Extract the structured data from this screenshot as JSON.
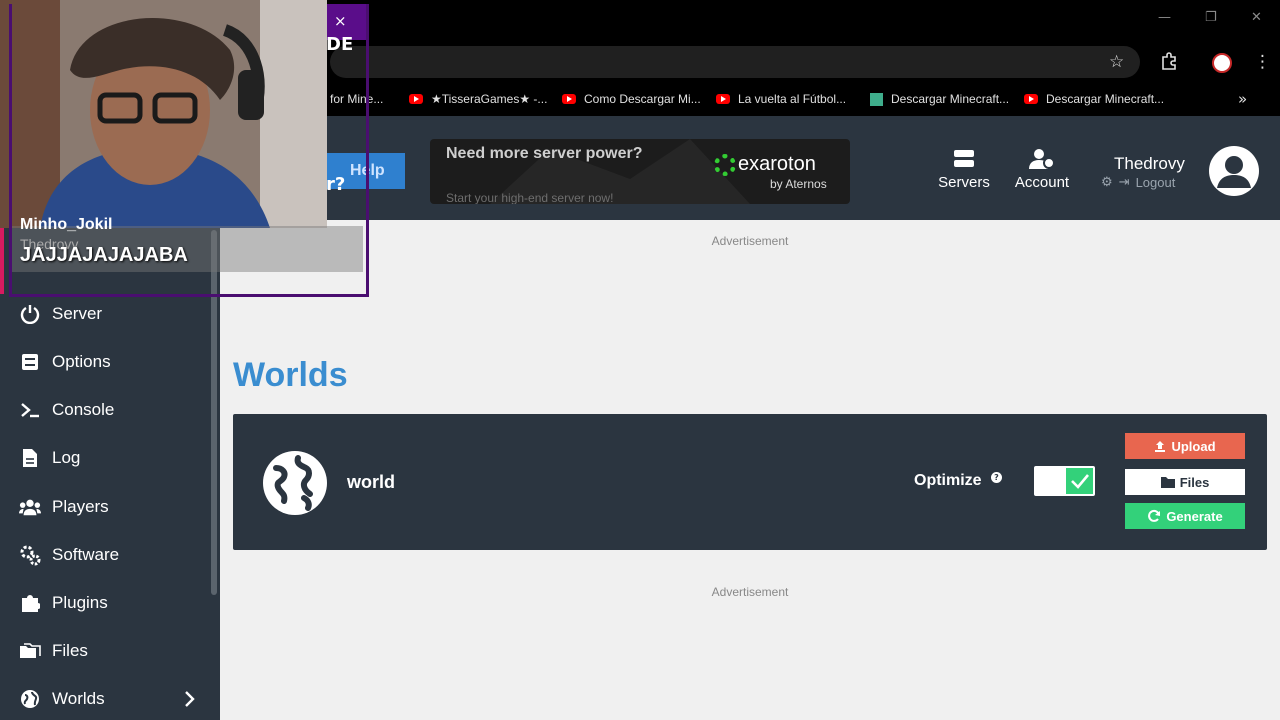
{
  "browser": {
    "tab_close": "×",
    "tab_text_fragment": "DE",
    "bookmarks": [
      {
        "label": "d for Mine...",
        "icon": "none"
      },
      {
        "label": "★TisseraGames★ -...",
        "icon": "youtube"
      },
      {
        "label": "Como Descargar Mi...",
        "icon": "youtube"
      },
      {
        "label": "La vuelta al Fútbol...",
        "icon": "youtube"
      },
      {
        "label": "Descargar Minecraft...",
        "icon": "minecraft"
      },
      {
        "label": "Descargar Minecraft...",
        "icon": "youtube"
      }
    ],
    "bookmarks_more": "»"
  },
  "header": {
    "help_label": "Help",
    "partial_text": "r?",
    "ad": {
      "headline": "Need more server power?",
      "subline": "Start your high-end server now!",
      "brand": "exaroton",
      "brand_by": "by Aternos"
    },
    "nav": [
      {
        "label": "Servers",
        "icon": "servers-icon"
      },
      {
        "label": "Account",
        "icon": "account-icon"
      }
    ],
    "username": "Thedrovy",
    "logout": "Logout"
  },
  "sidebar": {
    "items": [
      {
        "label": "Server",
        "icon": "power-icon"
      },
      {
        "label": "Options",
        "icon": "sliders-icon"
      },
      {
        "label": "Console",
        "icon": "terminal-icon"
      },
      {
        "label": "Log",
        "icon": "file-icon"
      },
      {
        "label": "Players",
        "icon": "users-icon"
      },
      {
        "label": "Software",
        "icon": "cogs-icon"
      },
      {
        "label": "Plugins",
        "icon": "puzzle-icon"
      },
      {
        "label": "Files",
        "icon": "folders-icon"
      },
      {
        "label": "Worlds",
        "icon": "globe-icon"
      }
    ]
  },
  "main": {
    "ad_label_top": "Advertisement",
    "title": "Worlds",
    "world": {
      "name": "world",
      "optimize_label": "Optimize",
      "optimize_enabled": true,
      "buttons": {
        "upload": "Upload",
        "files": "Files",
        "generate": "Generate"
      }
    },
    "ad_label_bottom": "Advertisement"
  },
  "overlay": {
    "chat_top": "Minho_Jokil",
    "chat_ghost": "Thedrovy",
    "chat_message": "JAJJAJAJAJABA"
  },
  "colors": {
    "panel_bg": "#2b3540",
    "accent_blue": "#3a8dd0",
    "upload_red": "#e8664f",
    "generate_green": "#33d17a"
  }
}
